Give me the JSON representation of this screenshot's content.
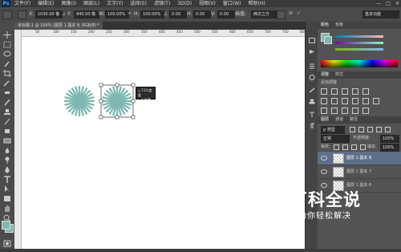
{
  "app": {
    "logo": "Ps"
  },
  "menu": {
    "items": [
      "文件(F)",
      "编辑(E)",
      "图像(I)",
      "图层(L)",
      "文字(Y)",
      "选择(S)",
      "滤镜(T)",
      "3D(D)",
      "视图(V)",
      "窗口(W)",
      "帮助(H)"
    ],
    "window_controls": [
      "—",
      "□",
      "✕"
    ]
  },
  "options": {
    "x_label": "X:",
    "x_value": "1030.00 像",
    "y_label": "Y:",
    "y_value": "940.00 像",
    "w_label": "W:",
    "w_value": "100.00%",
    "h_label": "H:",
    "h_value": "100.00%",
    "angle_value": "0.00",
    "hskew_label": "H:",
    "hskew_value": "0.00",
    "vskew_label": "V:",
    "vskew_value": "0.00",
    "interp_label": "插值:",
    "interp_value": "两次立方",
    "workspace_value": "基本功能"
  },
  "document": {
    "tab_label": "未标题-1 @ 100% (图层 1 副本 8, RGB/8) *",
    "ruler_ticks": [
      "50",
      "100",
      "150",
      "200",
      "250",
      "300",
      "350",
      "400",
      "450",
      "500",
      "550",
      "600",
      "650",
      "700",
      "750",
      "800"
    ],
    "transform_tooltip": {
      "line1": "△ 114 度度",
      "line2": "2 像素"
    }
  },
  "panels": {
    "color_tabs": [
      "颜色",
      "色板"
    ],
    "adjust_tabs": [
      "调整",
      "样式"
    ],
    "adjust_hint": "添加调整",
    "layers_tabs": [
      "图层",
      "通道",
      "路径"
    ],
    "filter_label": "ρ 类型",
    "blend_mode": "正常",
    "opacity_label": "不透明度:",
    "opacity_value": "100%",
    "lock_label": "锁定:",
    "fill_label": "填充:",
    "fill_value": "100%",
    "layers": [
      {
        "name": "图层 1 副本 8"
      },
      {
        "name": "图层 1 副本 7"
      },
      {
        "name": "图层 1 副本 6"
      }
    ]
  },
  "watermark": {
    "title": "百科全说",
    "subtitle": "助你轻松解决"
  },
  "colors": {
    "accent": "#7fb8b2",
    "panel": "#535353",
    "selected_layer": "#5d6f89"
  }
}
